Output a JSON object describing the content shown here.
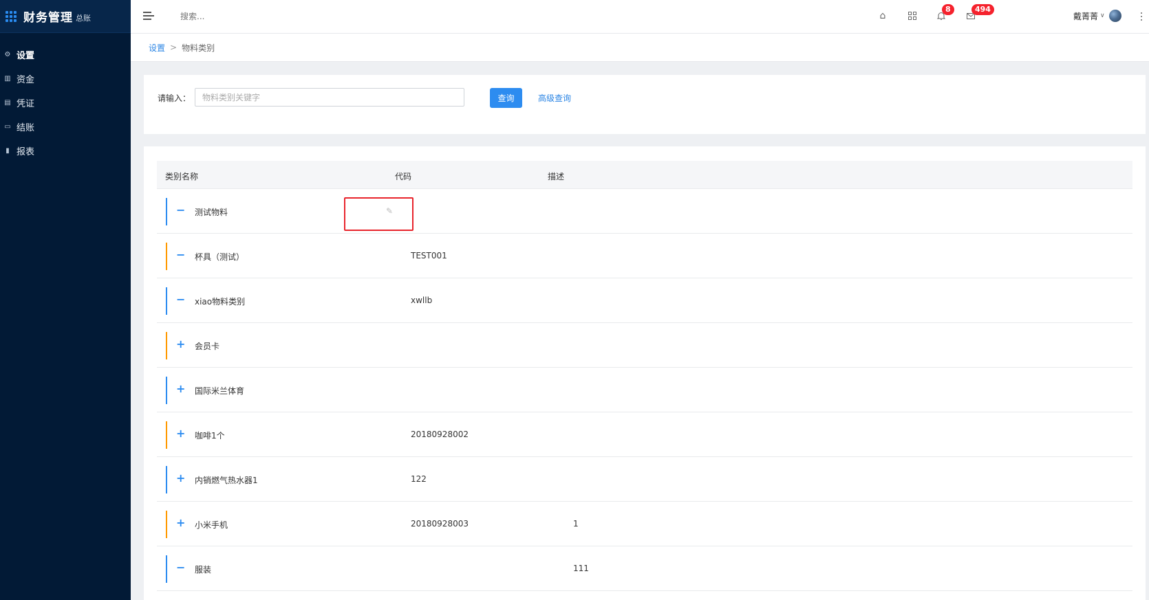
{
  "app": {
    "title": "财务管理",
    "subtitle": "总账"
  },
  "sidebar": {
    "items": [
      {
        "label": "设置",
        "icon": "gear-icon",
        "active": true
      },
      {
        "label": "资金",
        "icon": "funds-icon",
        "active": false
      },
      {
        "label": "凭证",
        "icon": "voucher-icon",
        "active": false
      },
      {
        "label": "结账",
        "icon": "wallet-icon",
        "active": false
      },
      {
        "label": "报表",
        "icon": "bar-chart-icon",
        "active": false
      }
    ]
  },
  "header": {
    "search_placeholder": "搜索...",
    "notifications_count": "8",
    "messages_count": "494",
    "user_name": "戴菁菁"
  },
  "breadcrumb": {
    "root": "设置",
    "separator": ">",
    "current": "物料类别"
  },
  "search": {
    "label": "请输入：",
    "placeholder": "物料类别关键字",
    "value": "",
    "query_button": "查询",
    "advanced_link": "高级查询"
  },
  "table": {
    "columns": [
      "类别名称",
      "代码",
      "描述"
    ],
    "rows": [
      {
        "name": "测试物料",
        "code": "",
        "desc": "",
        "expanded": true,
        "bar_color": "#2d8cf0",
        "editing": true
      },
      {
        "name": "杯具（测试）",
        "code": "TEST001",
        "desc": "",
        "expanded": true,
        "bar_color": "#ff9900",
        "editing": false
      },
      {
        "name": "xiao物料类别",
        "code": "xwllb",
        "desc": "",
        "expanded": true,
        "bar_color": "#2d8cf0",
        "editing": false
      },
      {
        "name": "会员卡",
        "code": "",
        "desc": "",
        "expanded": false,
        "bar_color": "#ff9900",
        "editing": false
      },
      {
        "name": "国际米兰体育",
        "code": "",
        "desc": "",
        "expanded": false,
        "bar_color": "#2d8cf0",
        "editing": false
      },
      {
        "name": "咖啡1个",
        "code": "20180928002",
        "desc": "",
        "expanded": false,
        "bar_color": "#ff9900",
        "editing": false
      },
      {
        "name": "内销燃气热水器1",
        "code": "122",
        "desc": "",
        "expanded": false,
        "bar_color": "#2d8cf0",
        "editing": false
      },
      {
        "name": "小米手机",
        "code": "20180928003",
        "desc": "1",
        "expanded": false,
        "bar_color": "#ff9900",
        "editing": false
      },
      {
        "name": "服装",
        "code": "",
        "desc": "111",
        "expanded": true,
        "bar_color": "#2d8cf0",
        "editing": false
      }
    ]
  },
  "symbols": {
    "expanded": "−",
    "collapsed": "+"
  }
}
